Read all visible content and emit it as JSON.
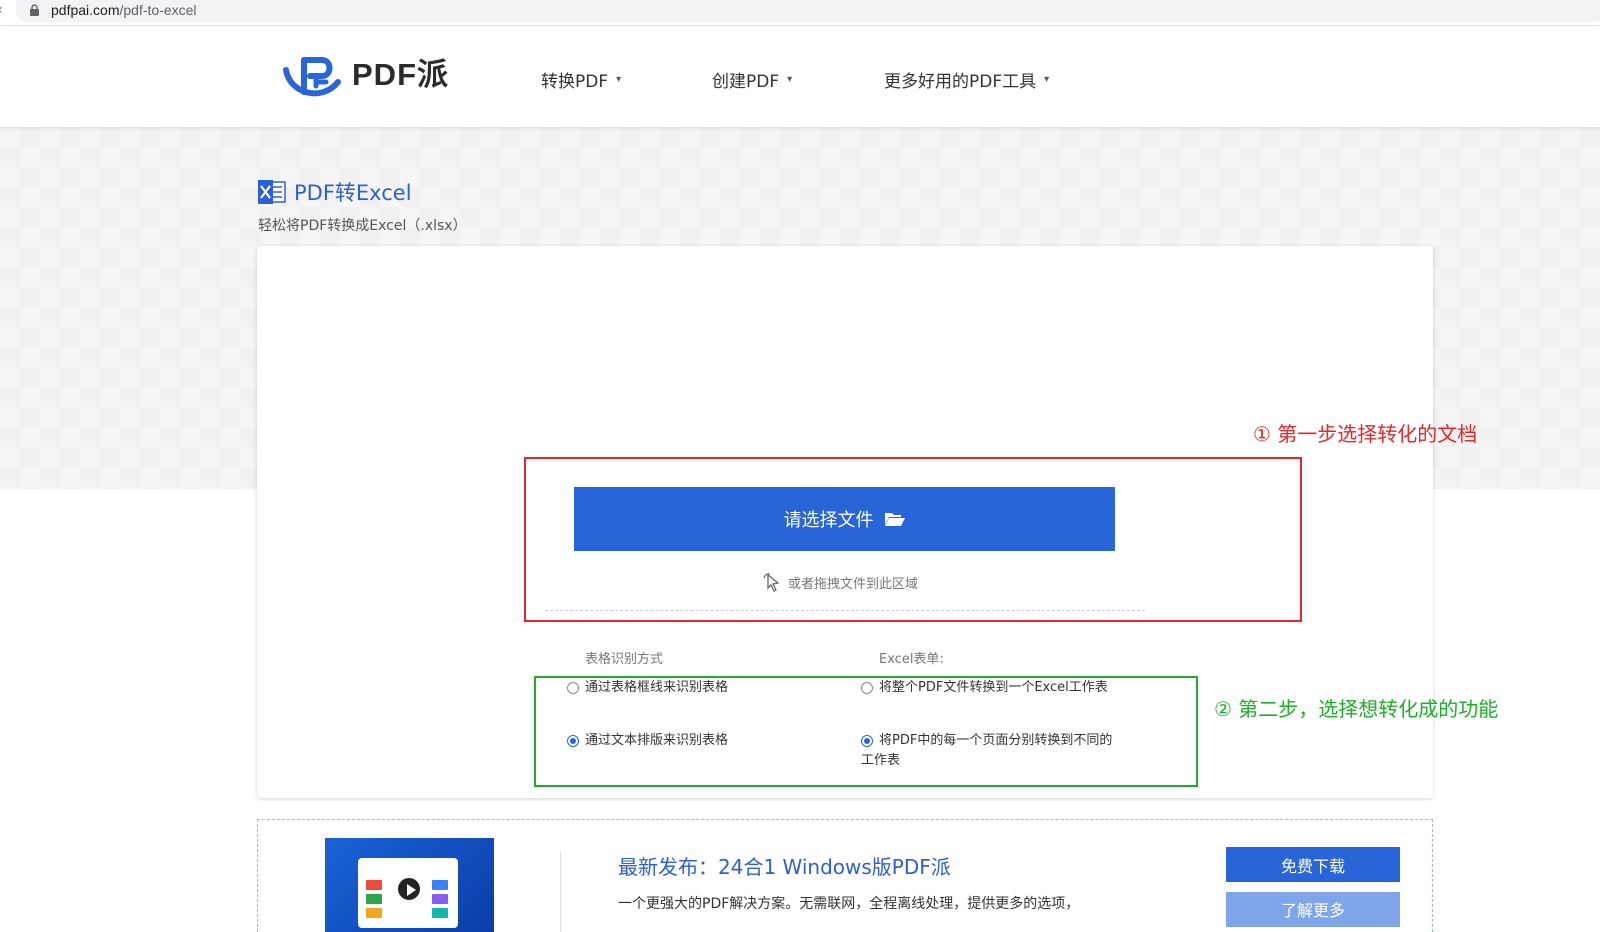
{
  "browser": {
    "url_host": "pdfpai.com",
    "url_path": "/pdf-to-excel"
  },
  "header": {
    "logo_text": "PDF派",
    "nav": [
      {
        "label": "转换PDF"
      },
      {
        "label": "创建PDF"
      },
      {
        "label": "更多好用的PDF工具"
      }
    ]
  },
  "page": {
    "title": "PDF转Excel",
    "subtitle": "轻松将PDF转换成Excel（.xlsx）"
  },
  "upload": {
    "button_label": "请选择文件",
    "drag_hint": "或者拖拽文件到此区域"
  },
  "annotations": {
    "step1": "① 第一步选择转化的文档",
    "step2": "② 第二步，选择想转化成的功能"
  },
  "options": {
    "table_mode_label": "表格识别方式",
    "sheet_label": "Excel表单:",
    "table_mode": [
      {
        "label": "通过表格框线来识别表格",
        "selected": false
      },
      {
        "label": "通过文本排版来识别表格",
        "selected": true
      }
    ],
    "sheet_mode": [
      {
        "label": "将整个PDF文件转换到一个Excel工作表",
        "selected": false
      },
      {
        "label": "将PDF中的每一个页面分别转换到不同的工作表",
        "selected": true
      }
    ]
  },
  "promo": {
    "title": "最新发布：24合1 Windows版PDF派",
    "description": "一个更强大的PDF解决方案。无需联网，全程离线处理，提供更多的选项，",
    "download_label": "免费下载",
    "more_label": "了解更多"
  },
  "colors": {
    "primary": "#2865d8",
    "title_blue": "#2d5fd6",
    "annotation_red": "#e8262b",
    "annotation_green": "#1fae2b"
  }
}
